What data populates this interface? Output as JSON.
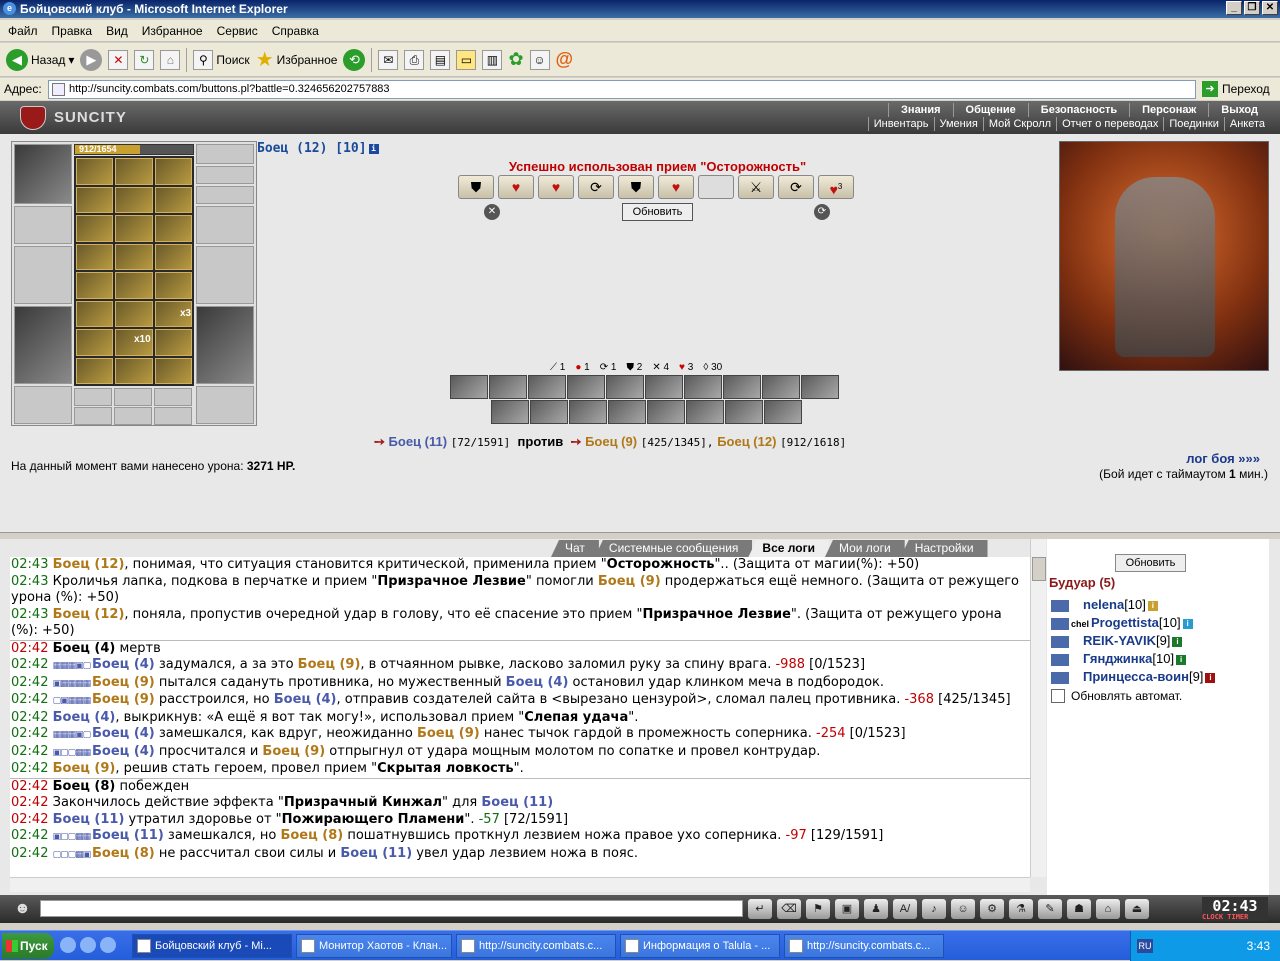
{
  "window": {
    "title": "Бойцовский клуб - Microsoft Internet Explorer"
  },
  "menu": [
    "Файл",
    "Правка",
    "Вид",
    "Избранное",
    "Сервис",
    "Справка"
  ],
  "toolbar": {
    "back": "Назад",
    "search": "Поиск",
    "favorites": "Избранное"
  },
  "address": {
    "label": "Адрес:",
    "url": "http://suncity.combats.com/buttons.pl?battle=0.324656202757883",
    "go": "Переход"
  },
  "site": {
    "logo": "SUNCITY",
    "nav_top": [
      "Знания",
      "Общение",
      "Безопасность",
      "Персонаж",
      "Выход"
    ],
    "nav_bottom": [
      "Инвентарь",
      "Умения",
      "Мой Скролл",
      "Отчет о переводах",
      "Поединки",
      "Анкета"
    ]
  },
  "character": {
    "hp": "912/1654",
    "hp_fraction": 0.551,
    "name": "Боец (12) [10]",
    "stack1": "x3",
    "stack2": "x10"
  },
  "battle": {
    "used_trick": "Успешно использован прием \"Осторожность\"",
    "refresh": "Обновить",
    "trick_count": "3",
    "counts": [
      "1",
      "1",
      "1",
      "2",
      "4",
      "3",
      "30"
    ],
    "f1": "Боец (11)",
    "f1_hp": "[72/1591]",
    "vs": "против",
    "f2": "Боец (9)",
    "f2_hp": "[425/1345],",
    "f3": "Боец (12)",
    "f3_hp": "[912/1618]",
    "damage_label": "На данный момент вами нанесено урона:",
    "damage_value": "3271 HP.",
    "log_link": "лог боя »»»",
    "timeout_pre": "(Бой идет с таймаутом",
    "timeout_val": "1",
    "timeout_post": "мин.)"
  },
  "tabs": [
    "Чат",
    "Системные сообщения",
    "Все логи",
    "Мои логи",
    "Настройки"
  ],
  "log": [
    {
      "t": "02:43",
      "html": "<span class='b2'>Боец (12)</span>, понимая, что ситуация становится критической, применила прием \"<b>Осторожность</b>\".. (Защита от магии(%): +50)"
    },
    {
      "t": "02:43",
      "html": "Кроличья лапка, подкова в перчатке и прием \"<b>Призрачное Лезвие</b>\" помогли <span class='b2'>Боец (9)</span> продержаться ещё немного. (Защита от режущего урона (%): +50)"
    },
    {
      "t": "02:43",
      "html": "<span class='b2'>Боец (12)</span>, поняла, пропустив очередной удар в голову, что её спасение это прием \"<b>Призрачное Лезвие</b>\". (Защита от режущего урона (%): +50)"
    },
    {
      "t": "02:42",
      "r": 1,
      "hr": 1,
      "html": "<b>Боец (4)</b> мертв"
    },
    {
      "t": "02:42",
      "bx": "▦▦▦▣▢",
      "html": "<span class='b1'>Боец (4)</span> задумался, а за это <span class='b2'>Боец (9)</span>, в отчаянном рывке, ласково заломил руку за спину врага. <span class='red'>-988</span> [0/1523]"
    },
    {
      "t": "02:42",
      "bx": "▣▦▦▦▦",
      "html": "<span class='b2'>Боец (9)</span> пытался садануть противника, но мужественный <span class='b1'>Боец (4)</span> остановил удар клинком меча в подбородок."
    },
    {
      "t": "02:42",
      "bx": "▢▣▦▦▦",
      "html": "<span class='b2'>Боец (9)</span> расстроился, но <span class='b1'>Боец (4)</span>, отправив создателей сайта в &lt;вырезано цензурой&gt;, сломал палец противника. <span class='red'>-368</span> [425/1345]"
    },
    {
      "t": "02:42",
      "html": "<span class='b1'>Боец (4)</span>, выкрикнув: «А ещё я вот так могу!», использовал прием \"<b>Слепая удача</b>\"."
    },
    {
      "t": "02:42",
      "bx": "▦▦▦▣▢",
      "html": "<span class='b1'>Боец (4)</span> замешкался, как вдруг, неожиданно <span class='b2'>Боец (9)</span> нанес тычок гардой в промежность соперника. <span class='red'>-254</span> [0/1523]"
    },
    {
      "t": "02:42",
      "bx": "▣▢▢▦▦",
      "html": "<span class='b1'>Боец (4)</span> просчитался и <span class='b2'>Боец (9)</span> отпрыгнул от удара мощным молотом по сопатке и провел контрудар."
    },
    {
      "t": "02:42",
      "html": "<span class='b2'>Боец (9)</span>, решив стать героем, провел прием \"<b>Скрытая ловкость</b>\"."
    },
    {
      "t": "02:42",
      "r": 1,
      "hr": 1,
      "html": "<b>Боец (8)</b> побежден"
    },
    {
      "t": "02:42",
      "r": 1,
      "html": "Закончилось действие эффекта \"<b>Призрачный Кинжал</b>\" для <span class='b1'>Боец (11)</span>"
    },
    {
      "t": "02:42",
      "r": 1,
      "html": "<span class='b1'>Боец (11)</span> утратил здоровье от \"<b>Пожирающего Пламени</b>\". <span class='grn'>-57</span> [72/1591]"
    },
    {
      "t": "02:42",
      "bx": "▣▢▢▦▦",
      "html": "<span class='b1'>Боец (11)</span> замешкался, но <span class='b2'>Боец (8)</span> пошатнувшись проткнул лезвием ножа правое ухо соперника. <span class='red'>-97</span> [129/1591]"
    },
    {
      "t": "02:42",
      "bx": "▢▢▢▦▣",
      "html": "<span class='b2'>Боец (8)</span> не рассчитал свои силы и <span class='b1'>Боец (11)</span> увел удар лезвием ножа в пояс."
    }
  ],
  "room": {
    "refresh": "Обновить",
    "title": "Будуар (5)",
    "autorefresh": "Обновлять автомат.",
    "users": [
      {
        "name": "nelena",
        "lvl": "[10]"
      },
      {
        "name": "Progettista",
        "lvl": "[10]",
        "clan": "chel"
      },
      {
        "name": "REIK-YAVIK",
        "lvl": "[9]"
      },
      {
        "name": "Гянджинка",
        "lvl": "[10]"
      },
      {
        "name": "Принцесса-воин",
        "lvl": "[9]"
      }
    ]
  },
  "clock": {
    "time": "02:43",
    "label": "CLOCK TIMER"
  },
  "taskbar": {
    "start": "Пуск",
    "tasks": [
      "Бойцовский клуб - Mi...",
      "Монитор Хаотов - Клан...",
      "http://suncity.combats.c...",
      "Информация о Talula - ...",
      "http://suncity.combats.c..."
    ],
    "lang": "RU",
    "time": "3:43"
  }
}
